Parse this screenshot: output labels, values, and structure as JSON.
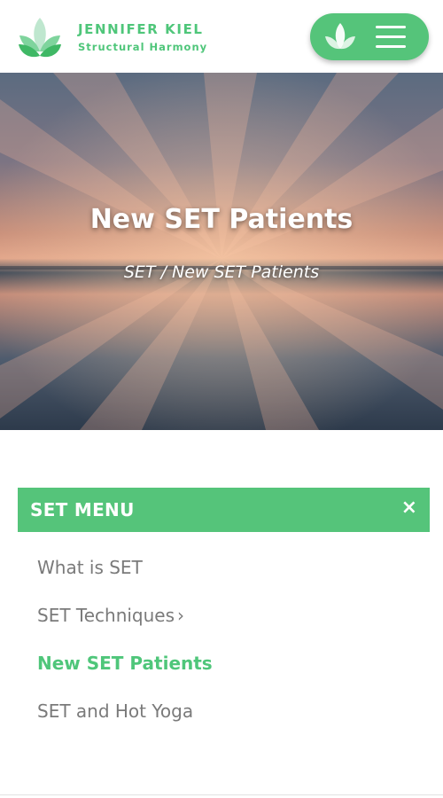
{
  "brand": {
    "name": "JENNIFER KIEL",
    "tagline": "Structural Harmony"
  },
  "hero": {
    "title": "New SET Patients",
    "breadcrumb": "SET / New SET Patients"
  },
  "set_menu": {
    "title": "SET MENU",
    "close_glyph": "×",
    "items": [
      {
        "label": "What is SET"
      },
      {
        "label": "SET Techniques",
        "chevron": "›"
      },
      {
        "label": "New SET Patients"
      },
      {
        "label": "SET and Hot Yoga"
      }
    ]
  },
  "colors": {
    "accent": "#55c47a",
    "text_muted": "#7a7a7a"
  },
  "icons": {
    "logo": "lotus-leaves-icon",
    "menu_leaf": "leaf-icon",
    "hamburger": "hamburger-icon",
    "close": "close-icon",
    "chevron": "chevron-right-icon"
  }
}
